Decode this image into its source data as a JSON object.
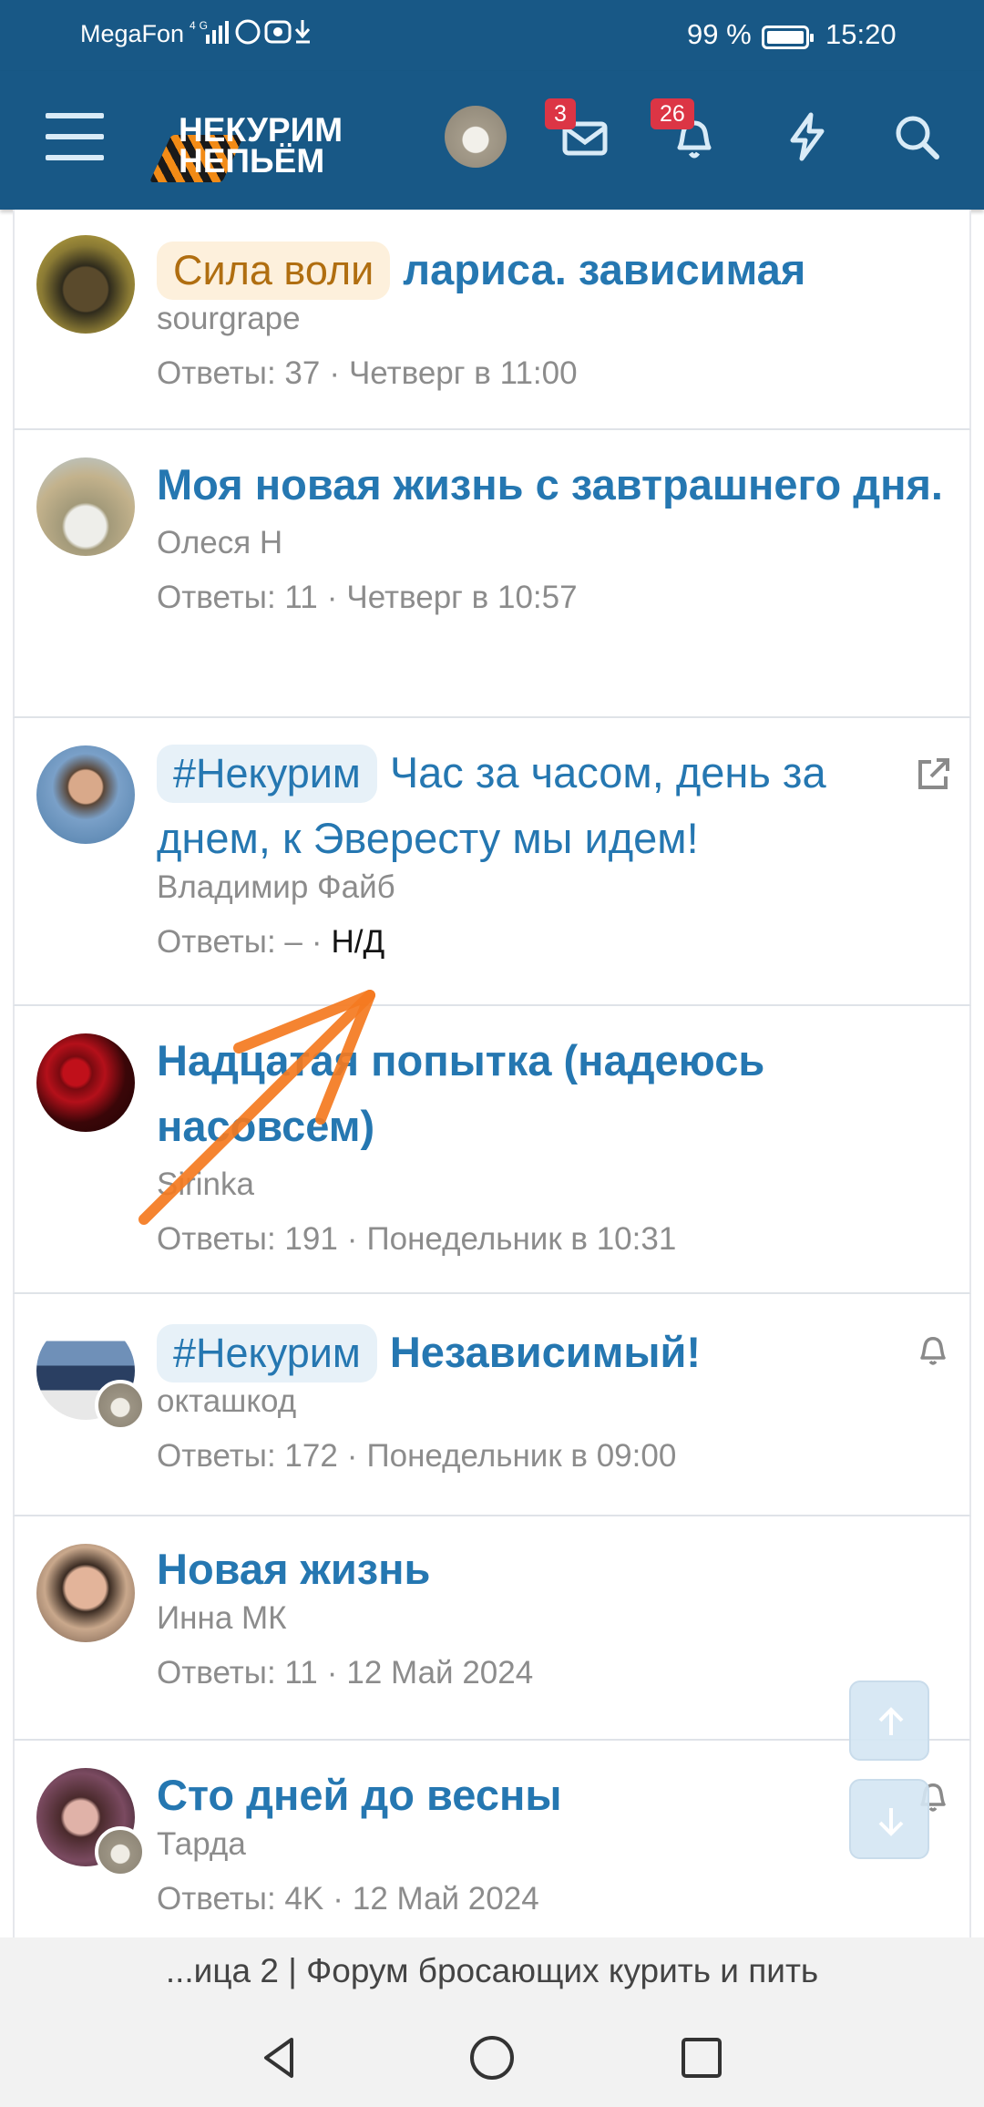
{
  "status_bar": {
    "carrier": "MegaFon",
    "network": "4G",
    "battery": "99 %",
    "time": "15:20"
  },
  "header": {
    "logo_line1": "НЕКУРИМ",
    "logo_line2": "НЕПЬЁМ",
    "messages_badge": "3",
    "alerts_badge": "26"
  },
  "threads": [
    {
      "prefix": "Сила воли",
      "prefix_style": "yellow",
      "title": "лариса. зависимая",
      "author": "sourgrape",
      "replies": "Ответы: 37",
      "date": "Четверг в 11:00"
    },
    {
      "prefix": "",
      "title": "Моя новая жизнь с завтрашнего дня.",
      "author": "Олеся Н",
      "replies": "Ответы: 11",
      "date": "Четверг в 10:57"
    },
    {
      "prefix": "#Некурим",
      "prefix_style": "blue",
      "title": "Час за часом, день за днем, к Эвересту мы идем!",
      "author": "Владимир Файб",
      "replies": "Ответы: –",
      "date": "Н/Д"
    },
    {
      "prefix": "",
      "title": "Надцатая попытка (надеюсь насовсем)",
      "author": "Sirinka",
      "replies": "Ответы: 191",
      "date": "Понедельник в 10:31"
    },
    {
      "prefix": "#Некурим",
      "prefix_style": "blue",
      "title": "Независимый!",
      "author": "окташкод",
      "replies": "Ответы: 172",
      "date": "Понедельник в 09:00"
    },
    {
      "prefix": "",
      "title": "Новая жизнь",
      "author": "Инна МК",
      "replies": "Ответы: 11",
      "date": "12 Май 2024"
    },
    {
      "prefix": "",
      "title": "Сто дней до весны",
      "author": "Тарда",
      "replies": "Ответы: 4K",
      "date": "12 Май 2024"
    }
  ],
  "url_bar": {
    "text": "...ица 2 | Форум бросающих курить и пить"
  },
  "colors": {
    "header_bg": "#185886",
    "link": "#2577b1",
    "annotation_arrow": "#f47a20",
    "badge": "#dc3545"
  }
}
